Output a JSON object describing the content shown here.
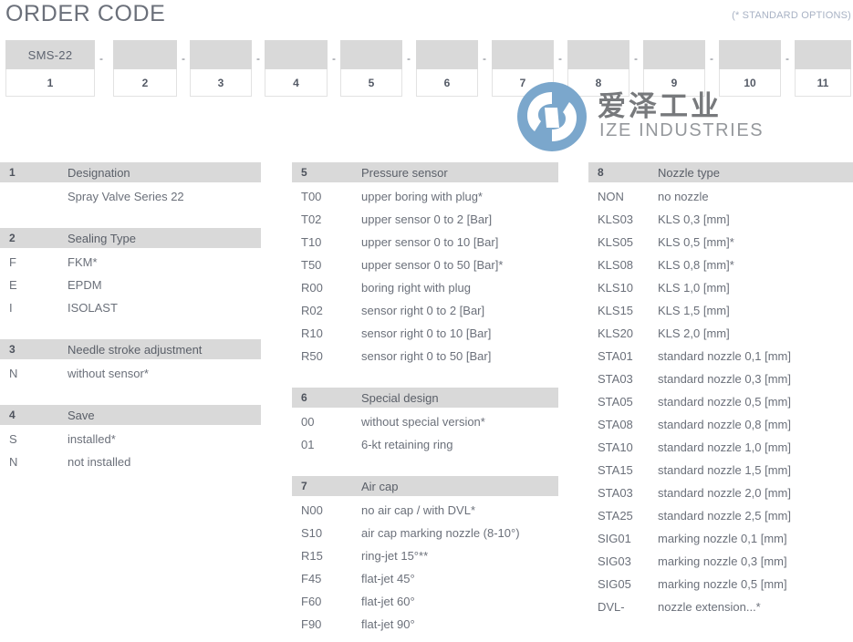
{
  "header": {
    "title": "ORDER CODE",
    "note": "(* STANDARD OPTIONS)"
  },
  "code_strip": {
    "prefix_value": "SMS-22",
    "separator": "-",
    "positions": [
      "1",
      "2",
      "3",
      "4",
      "5",
      "6",
      "7",
      "8",
      "9",
      "10",
      "11"
    ]
  },
  "logo": {
    "chinese": "爱泽工业",
    "english": "IZE INDUSTRIES",
    "color": "#7BA7CC"
  },
  "columns": [
    {
      "id": "column-1",
      "sections": [
        {
          "number": "1",
          "title": "Designation",
          "options": [
            {
              "code": "",
              "label": "Spray Valve Series 22"
            }
          ]
        },
        {
          "number": "2",
          "title": "Sealing Type",
          "options": [
            {
              "code": "F",
              "label": "FKM*"
            },
            {
              "code": "E",
              "label": "EPDM"
            },
            {
              "code": "I",
              "label": "ISOLAST"
            }
          ]
        },
        {
          "number": "3",
          "title": "Needle stroke adjustment",
          "options": [
            {
              "code": "N",
              "label": "without sensor*"
            }
          ]
        },
        {
          "number": "4",
          "title": "Save",
          "options": [
            {
              "code": "S",
              "label": "installed*"
            },
            {
              "code": "N",
              "label": "not installed"
            }
          ]
        }
      ]
    },
    {
      "id": "column-2",
      "sections": [
        {
          "number": "5",
          "title": "Pressure sensor",
          "options": [
            {
              "code": "T00",
              "label": "upper boring with plug*"
            },
            {
              "code": "T02",
              "label": "upper sensor 0 to 2 [Bar]"
            },
            {
              "code": "T10",
              "label": "upper sensor 0 to 10 [Bar]"
            },
            {
              "code": "T50",
              "label": "upper sensor 0 to 50 [Bar]*"
            },
            {
              "code": "R00",
              "label": "boring right with plug"
            },
            {
              "code": "R02",
              "label": "sensor right 0 to 2 [Bar]"
            },
            {
              "code": "R10",
              "label": "sensor right 0 to 10 [Bar]"
            },
            {
              "code": "R50",
              "label": "sensor right 0 to 50 [Bar]"
            }
          ]
        },
        {
          "number": "6",
          "title": "Special design",
          "options": [
            {
              "code": "00",
              "label": "without special version*"
            },
            {
              "code": "01",
              "label": "6-kt retaining ring"
            }
          ]
        },
        {
          "number": "7",
          "title": "Air cap",
          "options": [
            {
              "code": "N00",
              "label": "no air cap / with DVL*"
            },
            {
              "code": "S10",
              "label": "air cap marking nozzle (8-10°)"
            },
            {
              "code": "R15",
              "label": "ring-jet 15°**"
            },
            {
              "code": "F45",
              "label": "flat-jet 45°"
            },
            {
              "code": "F60",
              "label": "flat-jet 60°"
            },
            {
              "code": "F90",
              "label": "flat-jet 90°"
            }
          ]
        }
      ]
    },
    {
      "id": "column-3",
      "sections": [
        {
          "number": "8",
          "title": "Nozzle type",
          "options": [
            {
              "code": "NON",
              "label": "no nozzle"
            },
            {
              "code": "KLS03",
              "label": "KLS 0,3 [mm]"
            },
            {
              "code": "KLS05",
              "label": "KLS 0,5 [mm]*"
            },
            {
              "code": "KLS08",
              "label": "KLS 0,8 [mm]*"
            },
            {
              "code": "KLS10",
              "label": "KLS 1,0 [mm]"
            },
            {
              "code": "KLS15",
              "label": "KLS 1,5 [mm]"
            },
            {
              "code": "KLS20",
              "label": "KLS 2,0 [mm]"
            },
            {
              "code": "STA01",
              "label": "standard nozzle 0,1 [mm]"
            },
            {
              "code": "STA03",
              "label": "standard nozzle 0,3 [mm]"
            },
            {
              "code": "STA05",
              "label": "standard nozzle 0,5 [mm]"
            },
            {
              "code": "STA08",
              "label": "standard nozzle 0,8 [mm]"
            },
            {
              "code": "STA10",
              "label": "standard nozzle 1,0 [mm]"
            },
            {
              "code": "STA15",
              "label": "standard nozzle 1,5 [mm]"
            },
            {
              "code": "STA03",
              "label": "standard nozzle 2,0 [mm]"
            },
            {
              "code": "STA25",
              "label": "standard nozzle 2,5 [mm]"
            },
            {
              "code": "SIG01",
              "label": "marking nozzle 0,1 [mm]"
            },
            {
              "code": "SIG03",
              "label": "marking nozzle 0,3 [mm]"
            },
            {
              "code": "SIG05",
              "label": "marking nozzle 0,5 [mm]"
            },
            {
              "code": "DVL-",
              "label": "nozzle extension...*"
            }
          ]
        }
      ]
    }
  ]
}
